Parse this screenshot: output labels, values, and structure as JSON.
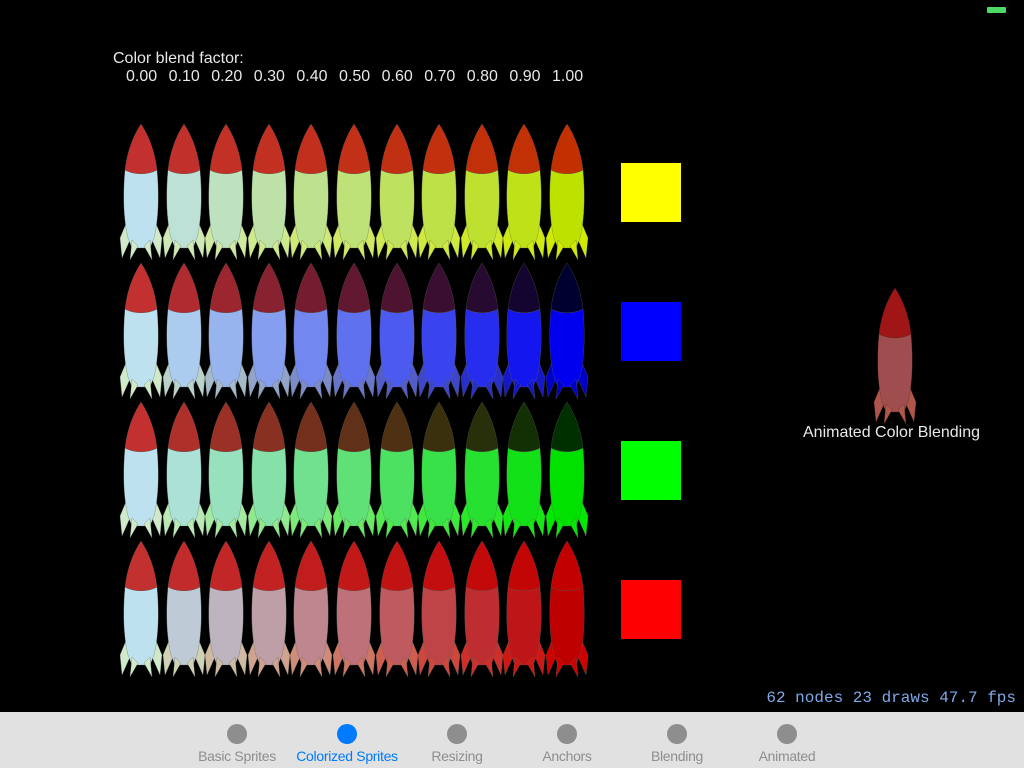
{
  "status_bar": {
    "battery_icon": "battery-icon",
    "battery_color": "#4cd964"
  },
  "scene": {
    "blend_title": "Color blend factor:",
    "blend_factors": [
      "0.00",
      "0.10",
      "0.20",
      "0.30",
      "0.40",
      "0.50",
      "0.60",
      "0.70",
      "0.80",
      "0.90",
      "1.00"
    ],
    "blend_values": [
      0.0,
      0.1,
      0.2,
      0.3,
      0.4,
      0.5,
      0.6,
      0.7,
      0.8,
      0.9,
      1.0
    ],
    "rocket_base_colors": {
      "nose": "#c23030",
      "body": "#bee1ef",
      "fins": "#cfe9c9",
      "outline": "#7a8a7a"
    },
    "rows": [
      {
        "name": "yellow",
        "tint": "#ffff00"
      },
      {
        "name": "blue",
        "tint": "#0000ff"
      },
      {
        "name": "green",
        "tint": "#00ff00"
      },
      {
        "name": "red",
        "tint": "#ff0000"
      }
    ],
    "animated": {
      "label": "Animated Color Blending",
      "nose": "#a01515",
      "body": "#a04d4f",
      "fins": "#b0554a"
    },
    "stats": "62 nodes 23 draws 47.7 fps"
  },
  "tabbar": {
    "active_index": 1,
    "tabs": [
      {
        "label": "Basic Sprites"
      },
      {
        "label": "Colorized Sprites"
      },
      {
        "label": "Resizing"
      },
      {
        "label": "Anchors"
      },
      {
        "label": "Blending"
      },
      {
        "label": "Animated"
      }
    ]
  }
}
